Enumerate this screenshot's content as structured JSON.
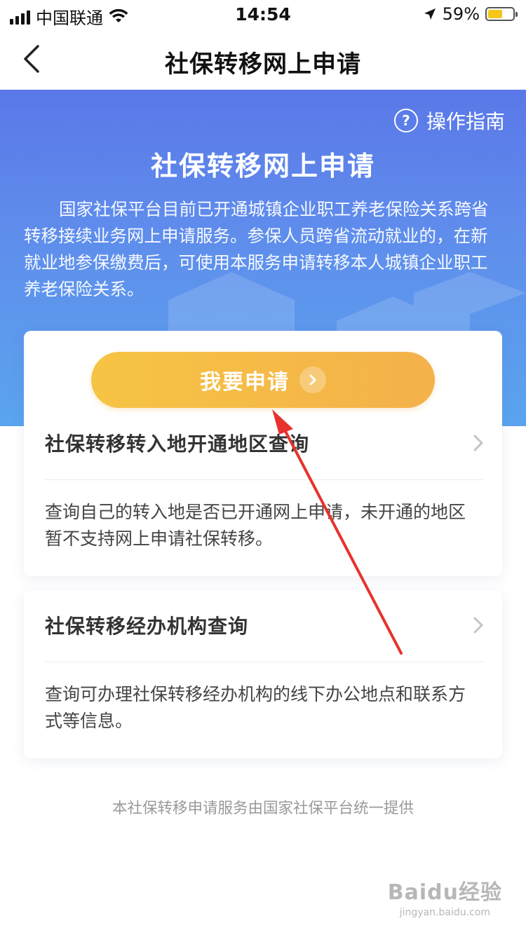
{
  "status_bar": {
    "carrier": "中国联通",
    "time": "14:54",
    "battery_percent": "59%",
    "battery_level": 0.59,
    "icons": [
      "signal-icon",
      "wifi-icon",
      "location-icon",
      "battery-icon"
    ]
  },
  "nav": {
    "title": "社保转移网上申请",
    "back_icon": "chevron-left-icon"
  },
  "hero": {
    "guide_label": "操作指南",
    "guide_icon_glyph": "?",
    "title": "社保转移网上申请",
    "description": "国家社保平台目前已开通城镇企业职工养老保险关系跨省转移接续业务网上申请服务。参保人员跨省流动就业的，在新就业地参保缴费后，可使用本服务申请转移本人城镇企业职工养老保险关系。"
  },
  "card1": {
    "apply_label": "我要申请",
    "row_title": "社保转移转入地开通地区查询",
    "row_desc": "查询自己的转入地是否已开通网上申请，未开通的地区暂不支持网上申请社保转移。"
  },
  "card2": {
    "row_title": "社保转移经办机构查询",
    "row_desc": "查询可办理社保转移经办机构的线下办公地点和联系方式等信息。"
  },
  "footer": {
    "note": "本社保转移申请服务由国家社保平台统一提供"
  },
  "watermark": {
    "main": "Baidu经验",
    "sub": "jingyan.baidu.com"
  },
  "colors": {
    "hero_top": "#5a78e8",
    "hero_bottom": "#5aa4ee",
    "apply_button": "#f5bb48",
    "annotation_arrow": "#e8322d"
  }
}
